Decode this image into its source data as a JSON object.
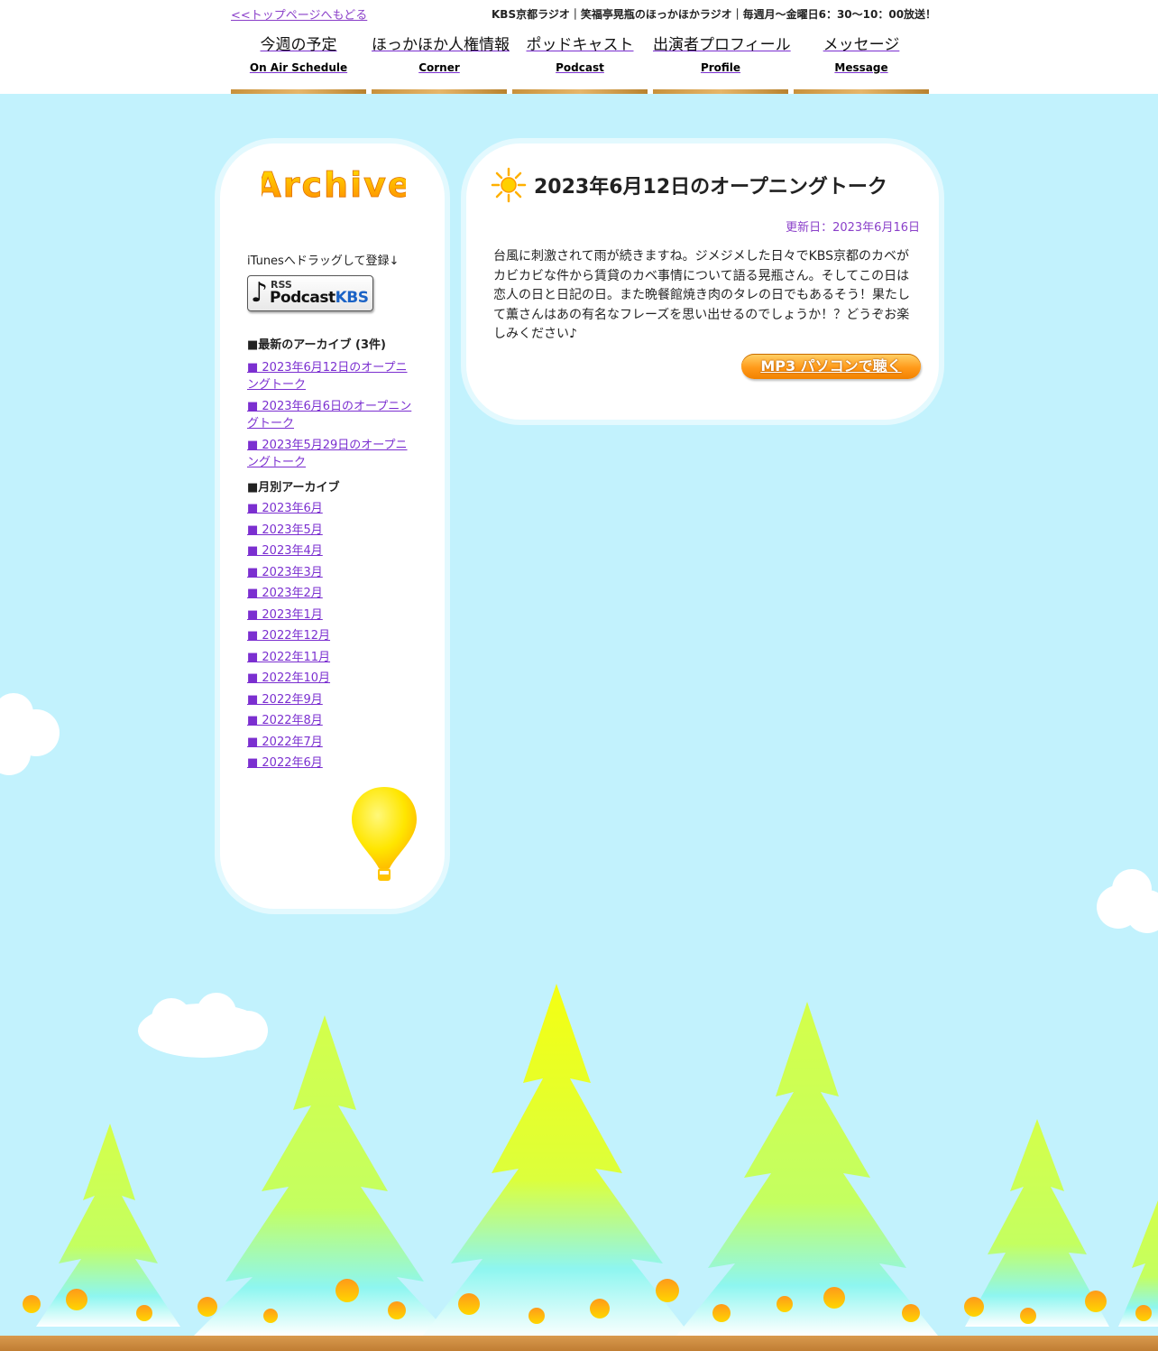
{
  "header": {
    "back_link": "<<トップページへもどる",
    "tagline": "KBS京都ラジオ｜笑福亭晃瓶のほっかほかラジオ｜毎週月～金曜日6：30～10：00放送！",
    "nav": [
      {
        "jp": "今週の予定",
        "en": "On Air Schedule"
      },
      {
        "jp": "ほっかほか人権情報",
        "en": "Corner"
      },
      {
        "jp": "ポッドキャスト",
        "en": "Podcast"
      },
      {
        "jp": "出演者プロフィール",
        "en": "Profile"
      },
      {
        "jp": "メッセージ",
        "en": "Message"
      }
    ]
  },
  "sidebar": {
    "logo_text": "Archive",
    "itunes_note": "iTunesへドラッグして登録↓",
    "rss_button": {
      "rss": "RSS",
      "podcast": "Podcast",
      "kbs": "KBS"
    },
    "recent_heading": "■最新のアーカイブ (3件)",
    "recent": [
      "■ 2023年6月12日のオープニングトーク",
      "■ 2023年6月6日のオープニングトーク",
      "■ 2023年5月29日のオープニングトーク"
    ],
    "monthly_heading": "■月別アーカイブ",
    "months": [
      "■ 2023年6月",
      "■ 2023年5月",
      "■ 2023年4月",
      "■ 2023年3月",
      "■ 2023年2月",
      "■ 2023年1月",
      "■ 2022年12月",
      "■ 2022年11月",
      "■ 2022年10月",
      "■ 2022年9月",
      "■ 2022年8月",
      "■ 2022年7月",
      "■ 2022年6月"
    ]
  },
  "post": {
    "title": "2023年6月12日のオープニングトーク",
    "updated": "更新日：2023年6月16日",
    "body": "台風に刺激されて雨が続きますね。ジメジメした日々でKBS京都のカベがカビカビな件から賃貸のカベ事情について語る晃瓶さん。そしてこの日は恋人の日と日記の日。また晩餐館焼き肉のタレの日でもあるそう！果たして薫さんはあの有名なフレーズを思い出せるのでしょうか！？どうぞお楽しみください♪",
    "mp3_button": "MP3 パソコンで聴く"
  },
  "colors": {
    "sky": "#c2f2fd",
    "link": "#8a3fc9",
    "nav_bar": "#c8913b",
    "mp3_orange": "#ff9a1a",
    "tree_yellow": "#f7ff00",
    "tree_cyan": "#8ef6f0"
  },
  "icons": {
    "sun": "sun-icon",
    "balloon": "balloon-icon",
    "music_note": "music-note-icon"
  }
}
